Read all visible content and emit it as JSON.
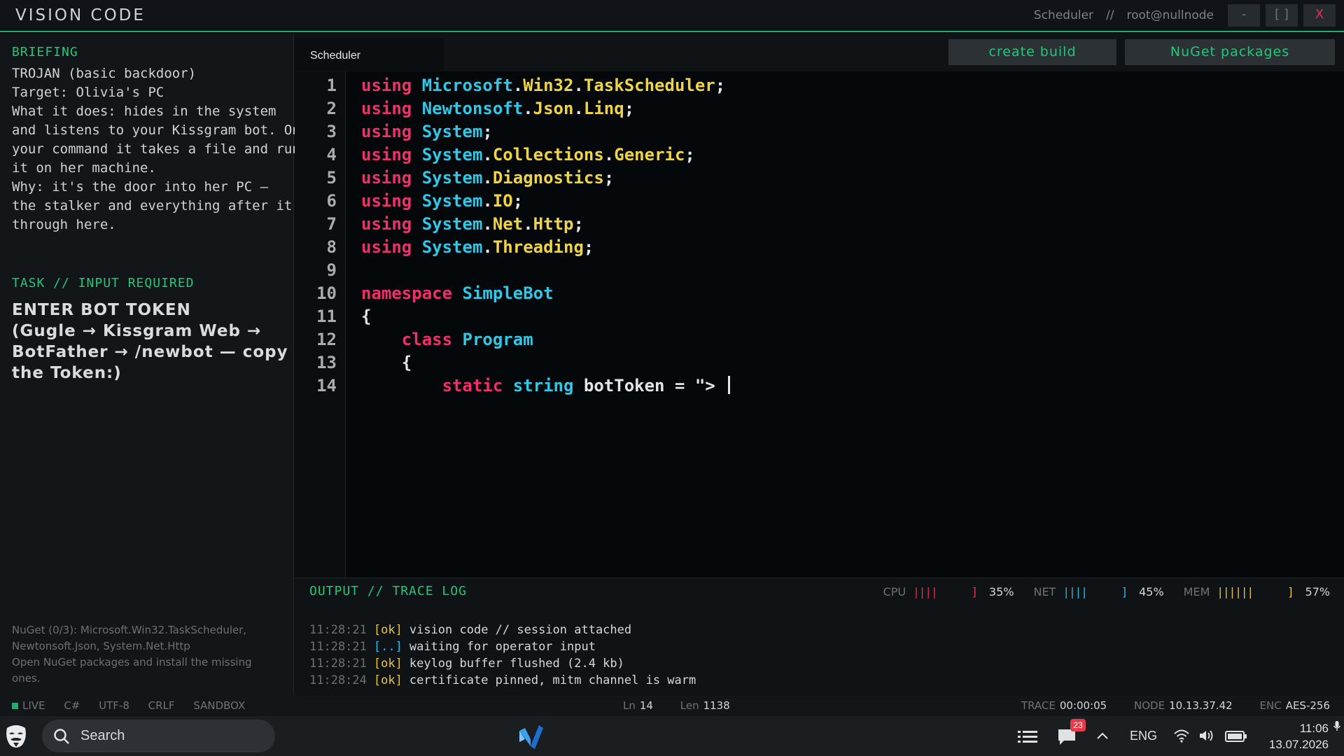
{
  "titlebar": {
    "app_title": "VISION CODE",
    "context": "Scheduler",
    "separator": "//",
    "user": "root@nullnode",
    "min_label": "-",
    "max_label": "[ ]",
    "close_label": "X"
  },
  "briefing": {
    "heading": "BRIEFING",
    "lines": [
      "TROJAN (basic backdoor)",
      "Target: Olivia's PC",
      "What it does: hides in the system",
      "and listens to your Kissgram bot. On",
      "your command it takes a file and runs",
      "it on her machine.",
      "Why: it's the door into her PC —",
      "the stalker and everything after it go",
      "through here."
    ]
  },
  "task": {
    "heading": "TASK // INPUT REQUIRED",
    "lines": [
      "ENTER BOT TOKEN",
      "(Gugle → Kissgram Web →",
      "BotFather → /newbot — copy",
      "the Token:)"
    ]
  },
  "nuget_note": {
    "lines": [
      "NuGet (0/3): Microsoft.Win32.TaskScheduler,",
      "Newtonsoft.Json, System.Net.Http",
      "Open NuGet packages and install the missing",
      "ones."
    ]
  },
  "tabs": [
    {
      "label": "Scheduler"
    }
  ],
  "toolbar": {
    "build_label": "create build",
    "nuget_label": "NuGet packages"
  },
  "code": {
    "lines": [
      {
        "num": "1",
        "tokens": [
          {
            "t": "using",
            "c": "kw"
          },
          {
            "t": " ",
            "c": "plain"
          },
          {
            "t": "Microsoft",
            "c": "ns"
          },
          {
            "t": ".",
            "c": "plain"
          },
          {
            "t": "Win32",
            "c": "ty"
          },
          {
            "t": ".",
            "c": "plain"
          },
          {
            "t": "TaskScheduler",
            "c": "ty"
          },
          {
            "t": ";",
            "c": "plain"
          }
        ]
      },
      {
        "num": "2",
        "tokens": [
          {
            "t": "using",
            "c": "kw"
          },
          {
            "t": " ",
            "c": "plain"
          },
          {
            "t": "Newtonsoft",
            "c": "ns"
          },
          {
            "t": ".",
            "c": "plain"
          },
          {
            "t": "Json",
            "c": "ty"
          },
          {
            "t": ".",
            "c": "plain"
          },
          {
            "t": "Linq",
            "c": "ty"
          },
          {
            "t": ";",
            "c": "plain"
          }
        ]
      },
      {
        "num": "3",
        "tokens": [
          {
            "t": "using",
            "c": "kw"
          },
          {
            "t": " ",
            "c": "plain"
          },
          {
            "t": "System",
            "c": "ns"
          },
          {
            "t": ";",
            "c": "plain"
          }
        ]
      },
      {
        "num": "4",
        "tokens": [
          {
            "t": "using",
            "c": "kw"
          },
          {
            "t": " ",
            "c": "plain"
          },
          {
            "t": "System",
            "c": "ns"
          },
          {
            "t": ".",
            "c": "plain"
          },
          {
            "t": "Collections",
            "c": "ty"
          },
          {
            "t": ".",
            "c": "plain"
          },
          {
            "t": "Generic",
            "c": "ty"
          },
          {
            "t": ";",
            "c": "plain"
          }
        ]
      },
      {
        "num": "5",
        "tokens": [
          {
            "t": "using",
            "c": "kw"
          },
          {
            "t": " ",
            "c": "plain"
          },
          {
            "t": "System",
            "c": "ns"
          },
          {
            "t": ".",
            "c": "plain"
          },
          {
            "t": "Diagnostics",
            "c": "ty"
          },
          {
            "t": ";",
            "c": "plain"
          }
        ]
      },
      {
        "num": "6",
        "tokens": [
          {
            "t": "using",
            "c": "kw"
          },
          {
            "t": " ",
            "c": "plain"
          },
          {
            "t": "System",
            "c": "ns"
          },
          {
            "t": ".",
            "c": "plain"
          },
          {
            "t": "IO",
            "c": "ty"
          },
          {
            "t": ";",
            "c": "plain"
          }
        ]
      },
      {
        "num": "7",
        "tokens": [
          {
            "t": "using",
            "c": "kw"
          },
          {
            "t": " ",
            "c": "plain"
          },
          {
            "t": "System",
            "c": "ns"
          },
          {
            "t": ".",
            "c": "plain"
          },
          {
            "t": "Net",
            "c": "ty"
          },
          {
            "t": ".",
            "c": "plain"
          },
          {
            "t": "Http",
            "c": "ty"
          },
          {
            "t": ";",
            "c": "plain"
          }
        ]
      },
      {
        "num": "8",
        "tokens": [
          {
            "t": "using",
            "c": "kw"
          },
          {
            "t": " ",
            "c": "plain"
          },
          {
            "t": "System",
            "c": "ns"
          },
          {
            "t": ".",
            "c": "plain"
          },
          {
            "t": "Threading",
            "c": "ty"
          },
          {
            "t": ";",
            "c": "plain"
          }
        ]
      },
      {
        "num": "9",
        "tokens": []
      },
      {
        "num": "10",
        "tokens": [
          {
            "t": "namespace",
            "c": "kw"
          },
          {
            "t": " ",
            "c": "plain"
          },
          {
            "t": "SimpleBot",
            "c": "ns"
          }
        ]
      },
      {
        "num": "11",
        "tokens": [
          {
            "t": "{",
            "c": "plain"
          }
        ]
      },
      {
        "num": "12",
        "tokens": [
          {
            "t": "    ",
            "c": "plain"
          },
          {
            "t": "class",
            "c": "kw"
          },
          {
            "t": " ",
            "c": "plain"
          },
          {
            "t": "Program",
            "c": "ns"
          }
        ]
      },
      {
        "num": "13",
        "tokens": [
          {
            "t": "    ",
            "c": "plain"
          },
          {
            "t": "{",
            "c": "plain"
          }
        ]
      },
      {
        "num": "14",
        "tokens": [
          {
            "t": "        ",
            "c": "plain"
          },
          {
            "t": "static",
            "c": "kw"
          },
          {
            "t": " ",
            "c": "plain"
          },
          {
            "t": "string",
            "c": "ns"
          },
          {
            "t": " botToken = \"> ",
            "c": "plain"
          }
        ],
        "cursor": true
      }
    ]
  },
  "output": {
    "heading": "OUTPUT // TRACE LOG",
    "meters": [
      {
        "label": "CPU",
        "bars": "||||",
        "close": "]",
        "pct": "35%",
        "value": 0.35,
        "color": "#e0344f"
      },
      {
        "label": "NET",
        "bars": "||||",
        "close": "]",
        "pct": "45%",
        "value": 0.45,
        "color": "#36b6e6"
      },
      {
        "label": "MEM",
        "bars": "||||||",
        "close": "]",
        "pct": "57%",
        "value": 0.57,
        "color": "#e6c44a"
      }
    ],
    "log": [
      {
        "time": "11:28:21",
        "status": "[ok]",
        "text": "vision code // session attached"
      },
      {
        "time": "11:28:21",
        "status": "[..]",
        "text": "waiting for operator input"
      },
      {
        "time": "11:28:21",
        "status": "[ok]",
        "text": "keylog buffer flushed (2.4 kb)"
      },
      {
        "time": "11:28:24",
        "status": "[ok]",
        "text": "certificate pinned, mitm channel is warm"
      }
    ]
  },
  "statusbar": {
    "live": "LIVE",
    "lang": "C#",
    "encoding": "UTF-8",
    "line_ending": "CRLF",
    "mode": "SANDBOX",
    "ln_label": "Ln",
    "ln_value": "14",
    "len_label": "Len",
    "len_value": "1138",
    "trace_label": "TRACE",
    "trace_value": "00:00:05",
    "node_label": "NODE",
    "node_value": "10.13.37.42",
    "enc_label": "ENC",
    "enc_value": "AES-256"
  },
  "taskbar": {
    "search_placeholder": "Search",
    "notification_count": "23",
    "language": "ENG",
    "time": "11:06",
    "date": "13.07.2026",
    "icons": [
      "start-mask-icon",
      "search-icon",
      "vs-code-icon",
      "task-list-icon",
      "chat-icon",
      "chevron-up-icon",
      "wifi-icon",
      "volume-icon",
      "battery-icon",
      "mic-icon"
    ]
  },
  "colors": {
    "accent_green": "#1fae6a",
    "keyword": "#f0306a",
    "namespace": "#31c7e6",
    "type": "#f0d447",
    "log_ok": "#e6c44a",
    "log_pending": "#36b6e6"
  }
}
